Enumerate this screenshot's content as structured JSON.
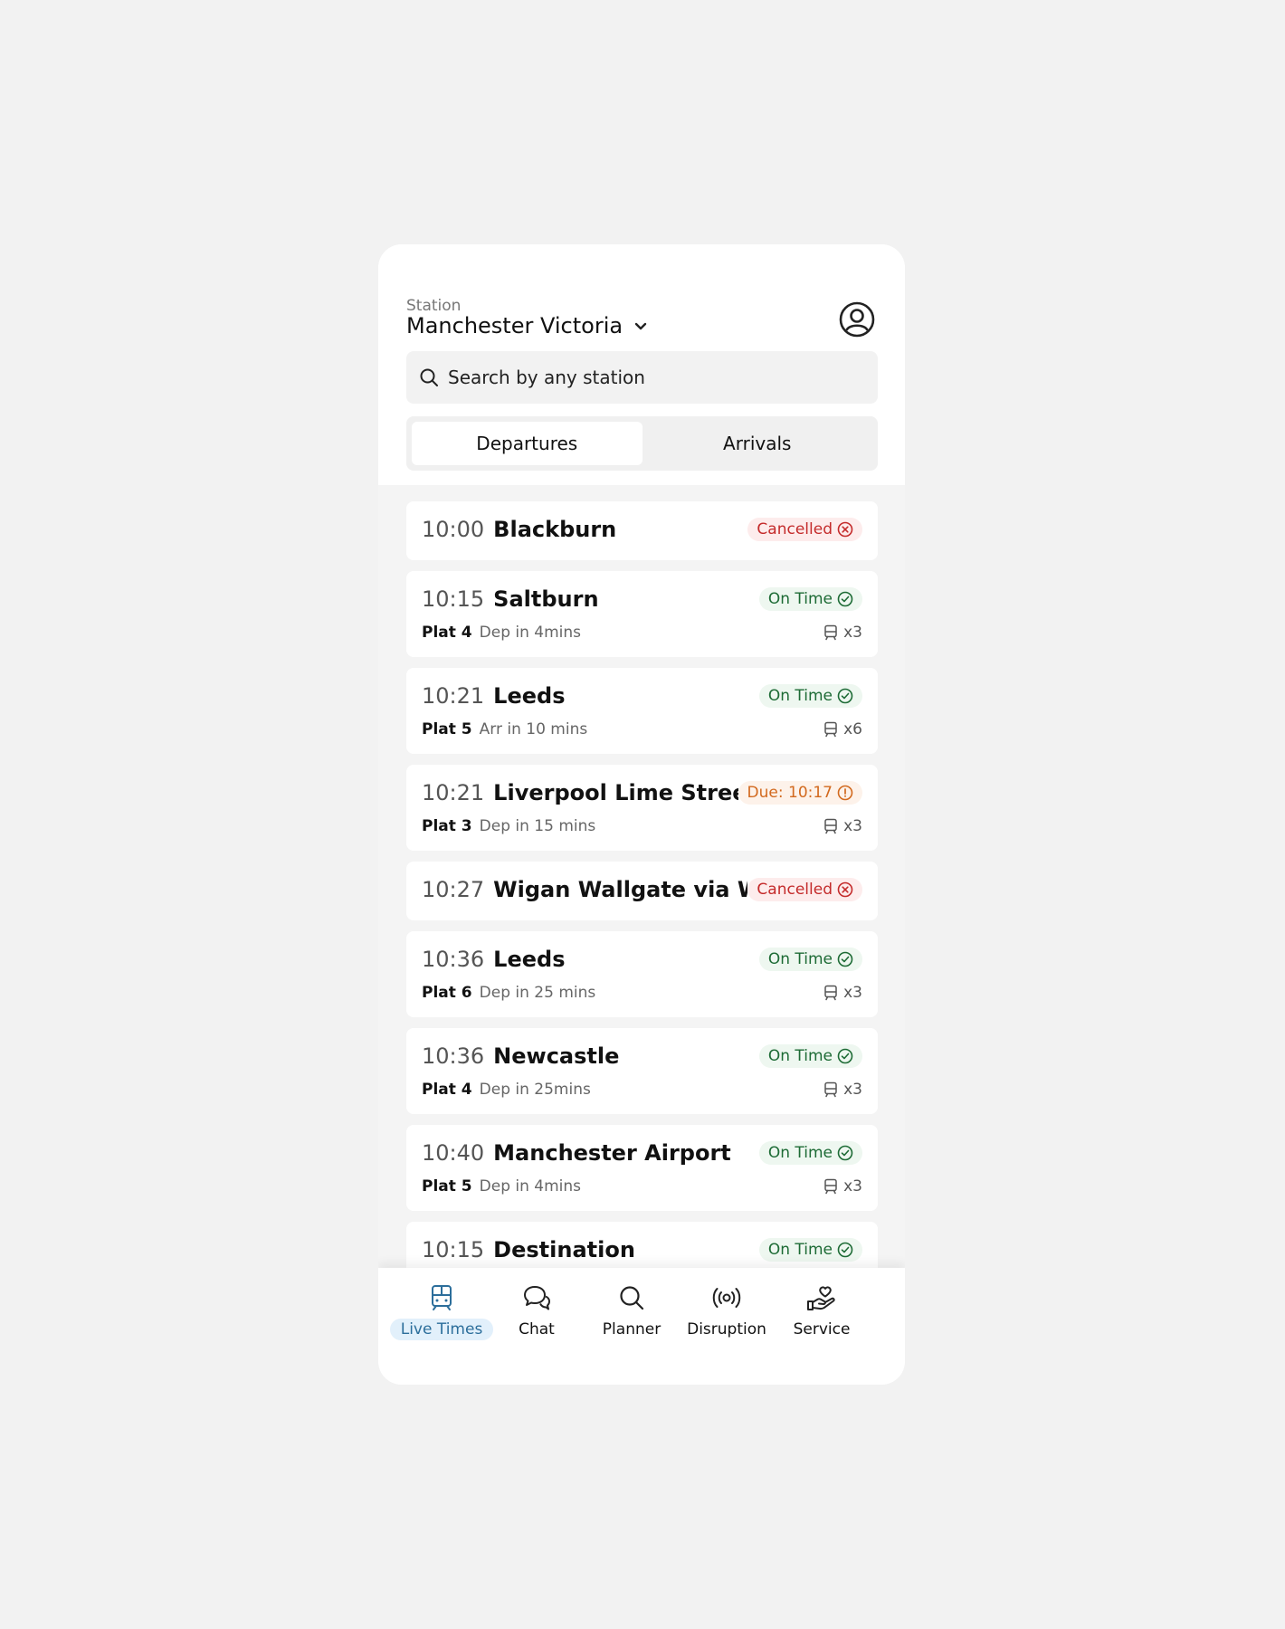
{
  "header": {
    "station_label": "Station",
    "station_name": "Manchester Victoria"
  },
  "search": {
    "placeholder": "Search by any station"
  },
  "tabs": [
    {
      "label": "Departures",
      "active": true
    },
    {
      "label": "Arrivals",
      "active": false
    }
  ],
  "services": [
    {
      "time": "10:00",
      "destination": "Blackburn",
      "status": "Cancelled",
      "status_type": "cancelled"
    },
    {
      "time": "10:15",
      "destination": "Saltburn",
      "status": "On Time",
      "status_type": "ontime",
      "platform": "Plat 4",
      "info": "Dep in 4mins",
      "cars": "x3"
    },
    {
      "time": "10:21",
      "destination": "Leeds",
      "status": "On Time",
      "status_type": "ontime",
      "platform": "Plat 5",
      "info": "Arr in 10 mins",
      "cars": "x6"
    },
    {
      "time": "10:21",
      "destination": "Liverpool Lime Street",
      "status": "Due: 10:17",
      "status_type": "due",
      "platform": "Plat 3",
      "info": "Dep in 15 mins",
      "cars": "x3"
    },
    {
      "time": "10:27",
      "destination": "Wigan Wallgate via Wi...",
      "status": "Cancelled",
      "status_type": "cancelled"
    },
    {
      "time": "10:36",
      "destination": "Leeds",
      "status": "On Time",
      "status_type": "ontime",
      "platform": "Plat 6",
      "info": "Dep in 25 mins",
      "cars": "x3"
    },
    {
      "time": "10:36",
      "destination": "Newcastle",
      "status": "On Time",
      "status_type": "ontime",
      "platform": "Plat 4",
      "info": "Dep in 25mins",
      "cars": "x3"
    },
    {
      "time": "10:40",
      "destination": "Manchester Airport",
      "status": "On Time",
      "status_type": "ontime",
      "platform": "Plat 5",
      "info": "Dep in 4mins",
      "cars": "x3"
    },
    {
      "time": "10:15",
      "destination": "Destination",
      "status": "On Time",
      "status_type": "ontime",
      "platform": "",
      "info": "",
      "cars": ""
    }
  ],
  "nav": [
    {
      "label": "Live Times",
      "icon": "train-icon",
      "active": true
    },
    {
      "label": "Chat",
      "icon": "chat-icon",
      "active": false
    },
    {
      "label": "Planner",
      "icon": "search-icon",
      "active": false
    },
    {
      "label": "Disruption",
      "icon": "broadcast-icon",
      "active": false
    },
    {
      "label": "Service",
      "icon": "hand-heart-icon",
      "active": false
    }
  ],
  "colors": {
    "ontime": "#1d6b35",
    "cancelled": "#c42b2b",
    "due": "#d2691e",
    "active_nav": "#2c6e9b"
  }
}
